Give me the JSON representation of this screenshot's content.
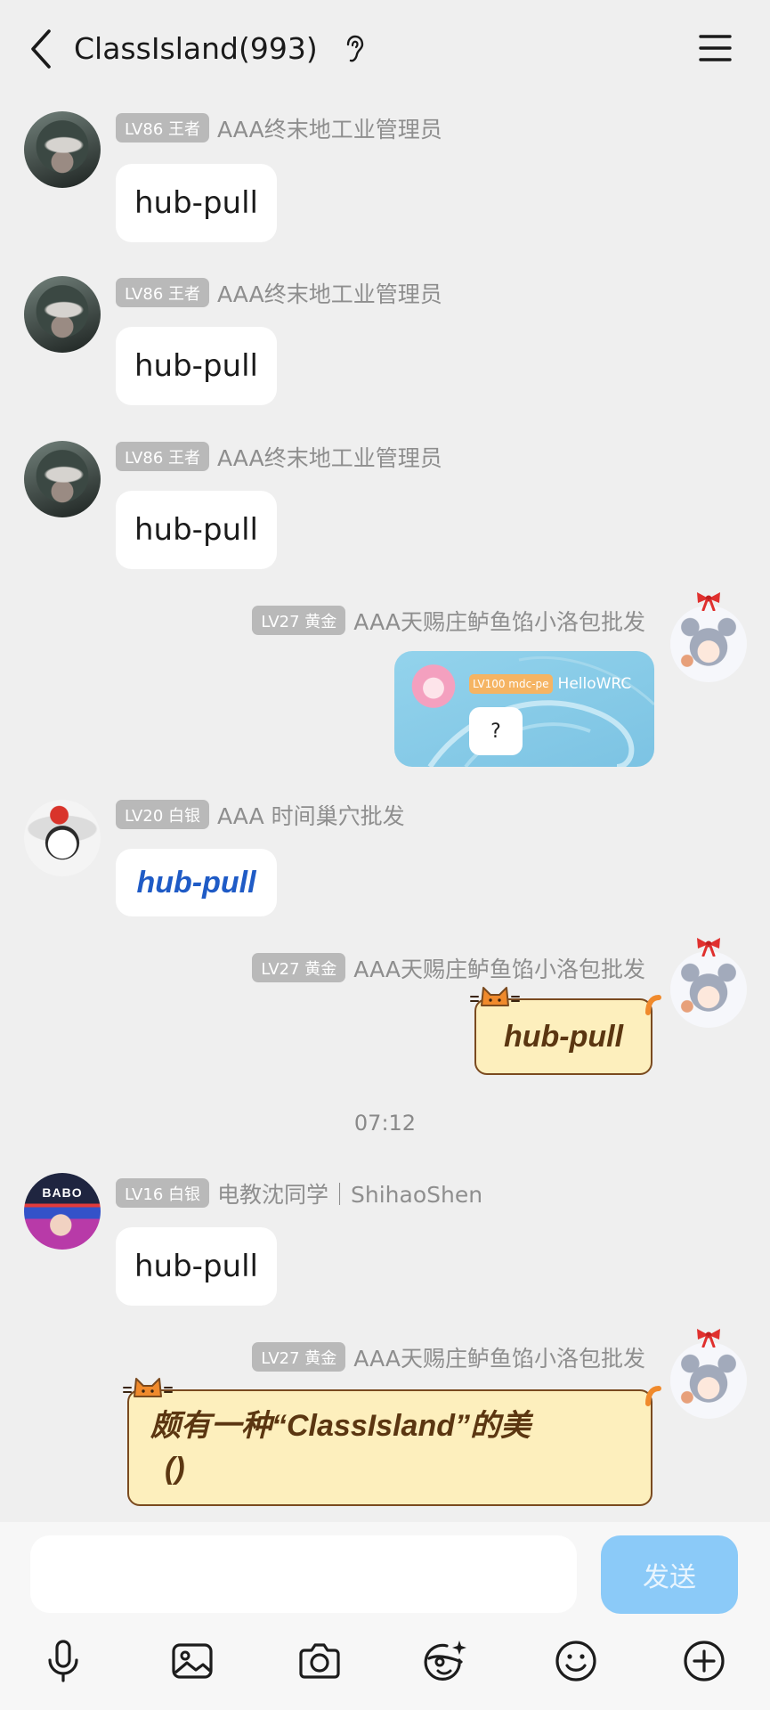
{
  "header": {
    "title": "ClassIsland(993)",
    "back_icon": "chevron-left-icon",
    "status_icon": "ear-icon",
    "menu_icon": "hamburger-menu-icon"
  },
  "messages": [
    {
      "badge": "LV86 王者",
      "sender": "AAA终末地工业管理员",
      "text": "hub-pull"
    },
    {
      "badge": "LV86 王者",
      "sender": "AAA终末地工业管理员",
      "text": "hub-pull"
    },
    {
      "badge": "LV86 王者",
      "sender": "AAA终末地工业管理员",
      "text": "hub-pull"
    },
    {
      "badge": "LV27 黄金",
      "sender": "AAA天赐庄鲈鱼馅小洛包批发",
      "image": {
        "badge": "LV100 mdc-pe",
        "sender": "HelloWRC",
        "text": "?"
      }
    },
    {
      "badge": "LV20 白银",
      "sender": "AAA 时间巢穴批发",
      "text": "hub-pull"
    },
    {
      "badge": "LV27 黄金",
      "sender": "AAA天赐庄鲈鱼馅小洛包批发",
      "text": "hub-pull"
    },
    {
      "badge": "LV16 白银",
      "sender": "电教沈同学｜ShihaoShen",
      "text": "hub-pull",
      "avatar_text": "BABO"
    },
    {
      "badge": "LV27 黄金",
      "sender": "AAA天赐庄鲈鱼馅小洛包批发",
      "lines": [
        "颇有一种“ClassIsland”的美",
        "()"
      ]
    }
  ],
  "timestamp": "07:12",
  "composer": {
    "input": {
      "value": "",
      "placeholder": ""
    },
    "send_label": "发送"
  },
  "toolbar": {
    "icons": [
      "microphone-icon",
      "image-icon",
      "camera-icon",
      "face-sparkle-icon",
      "smile-icon",
      "plus-circle-icon"
    ]
  },
  "colors": {
    "background": "#efefef",
    "composer_bg": "#f7f7f7",
    "badge_gray": "#b9b9b9",
    "badge_orange": "#f5b463",
    "sender_gray": "#8e8e8e",
    "link_blue": "#1f5bc6",
    "cat_fill": "#fdefbd",
    "cat_border": "#7a4a1f",
    "cat_text": "#5b3611",
    "send_button": "#8bcaf8",
    "send_text": "#e9f5fe"
  }
}
